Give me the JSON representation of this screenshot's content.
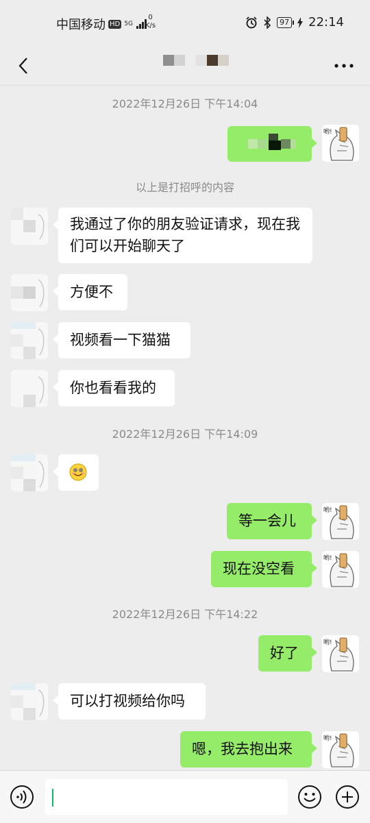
{
  "status_bar": {
    "carrier": "中国移动",
    "hd_badge": "HD",
    "network": "5G",
    "speed_value": "0",
    "speed_unit": "K/s",
    "battery": "97",
    "time": "22:14"
  },
  "messages": [
    {
      "type": "time",
      "text": "2022年12月26日 下午14:04"
    },
    {
      "type": "sent",
      "text": "",
      "note": "pixelated"
    },
    {
      "type": "system",
      "text": "以上是打招呼的内容"
    },
    {
      "type": "received",
      "text": "我通过了你的朋友验证请求，现在我们可以开始聊天了"
    },
    {
      "type": "received",
      "text": "方便不"
    },
    {
      "type": "received",
      "text": "视频看一下猫猫"
    },
    {
      "type": "received",
      "text": "你也看看我的"
    },
    {
      "type": "time",
      "text": "2022年12月26日 下午14:09"
    },
    {
      "type": "received",
      "text": "",
      "emoji": "smile"
    },
    {
      "type": "sent",
      "text": "等一会儿"
    },
    {
      "type": "sent",
      "text": "现在没空看"
    },
    {
      "type": "time",
      "text": "2022年12月26日 下午14:22"
    },
    {
      "type": "sent",
      "text": "好了"
    },
    {
      "type": "received",
      "text": "可以打视频给你吗"
    },
    {
      "type": "sent",
      "text": "嗯，我去抱出来"
    }
  ],
  "self_avatar_label": "哟!",
  "icons": {
    "back": "back-icon",
    "more": "more-icon",
    "voice": "voice-icon",
    "emoji": "emoji-icon",
    "plus": "plus-icon"
  },
  "colors": {
    "sent_bubble": "#95ec69",
    "received_bubble": "#ffffff",
    "background": "#ededed",
    "caret": "#07c160"
  }
}
